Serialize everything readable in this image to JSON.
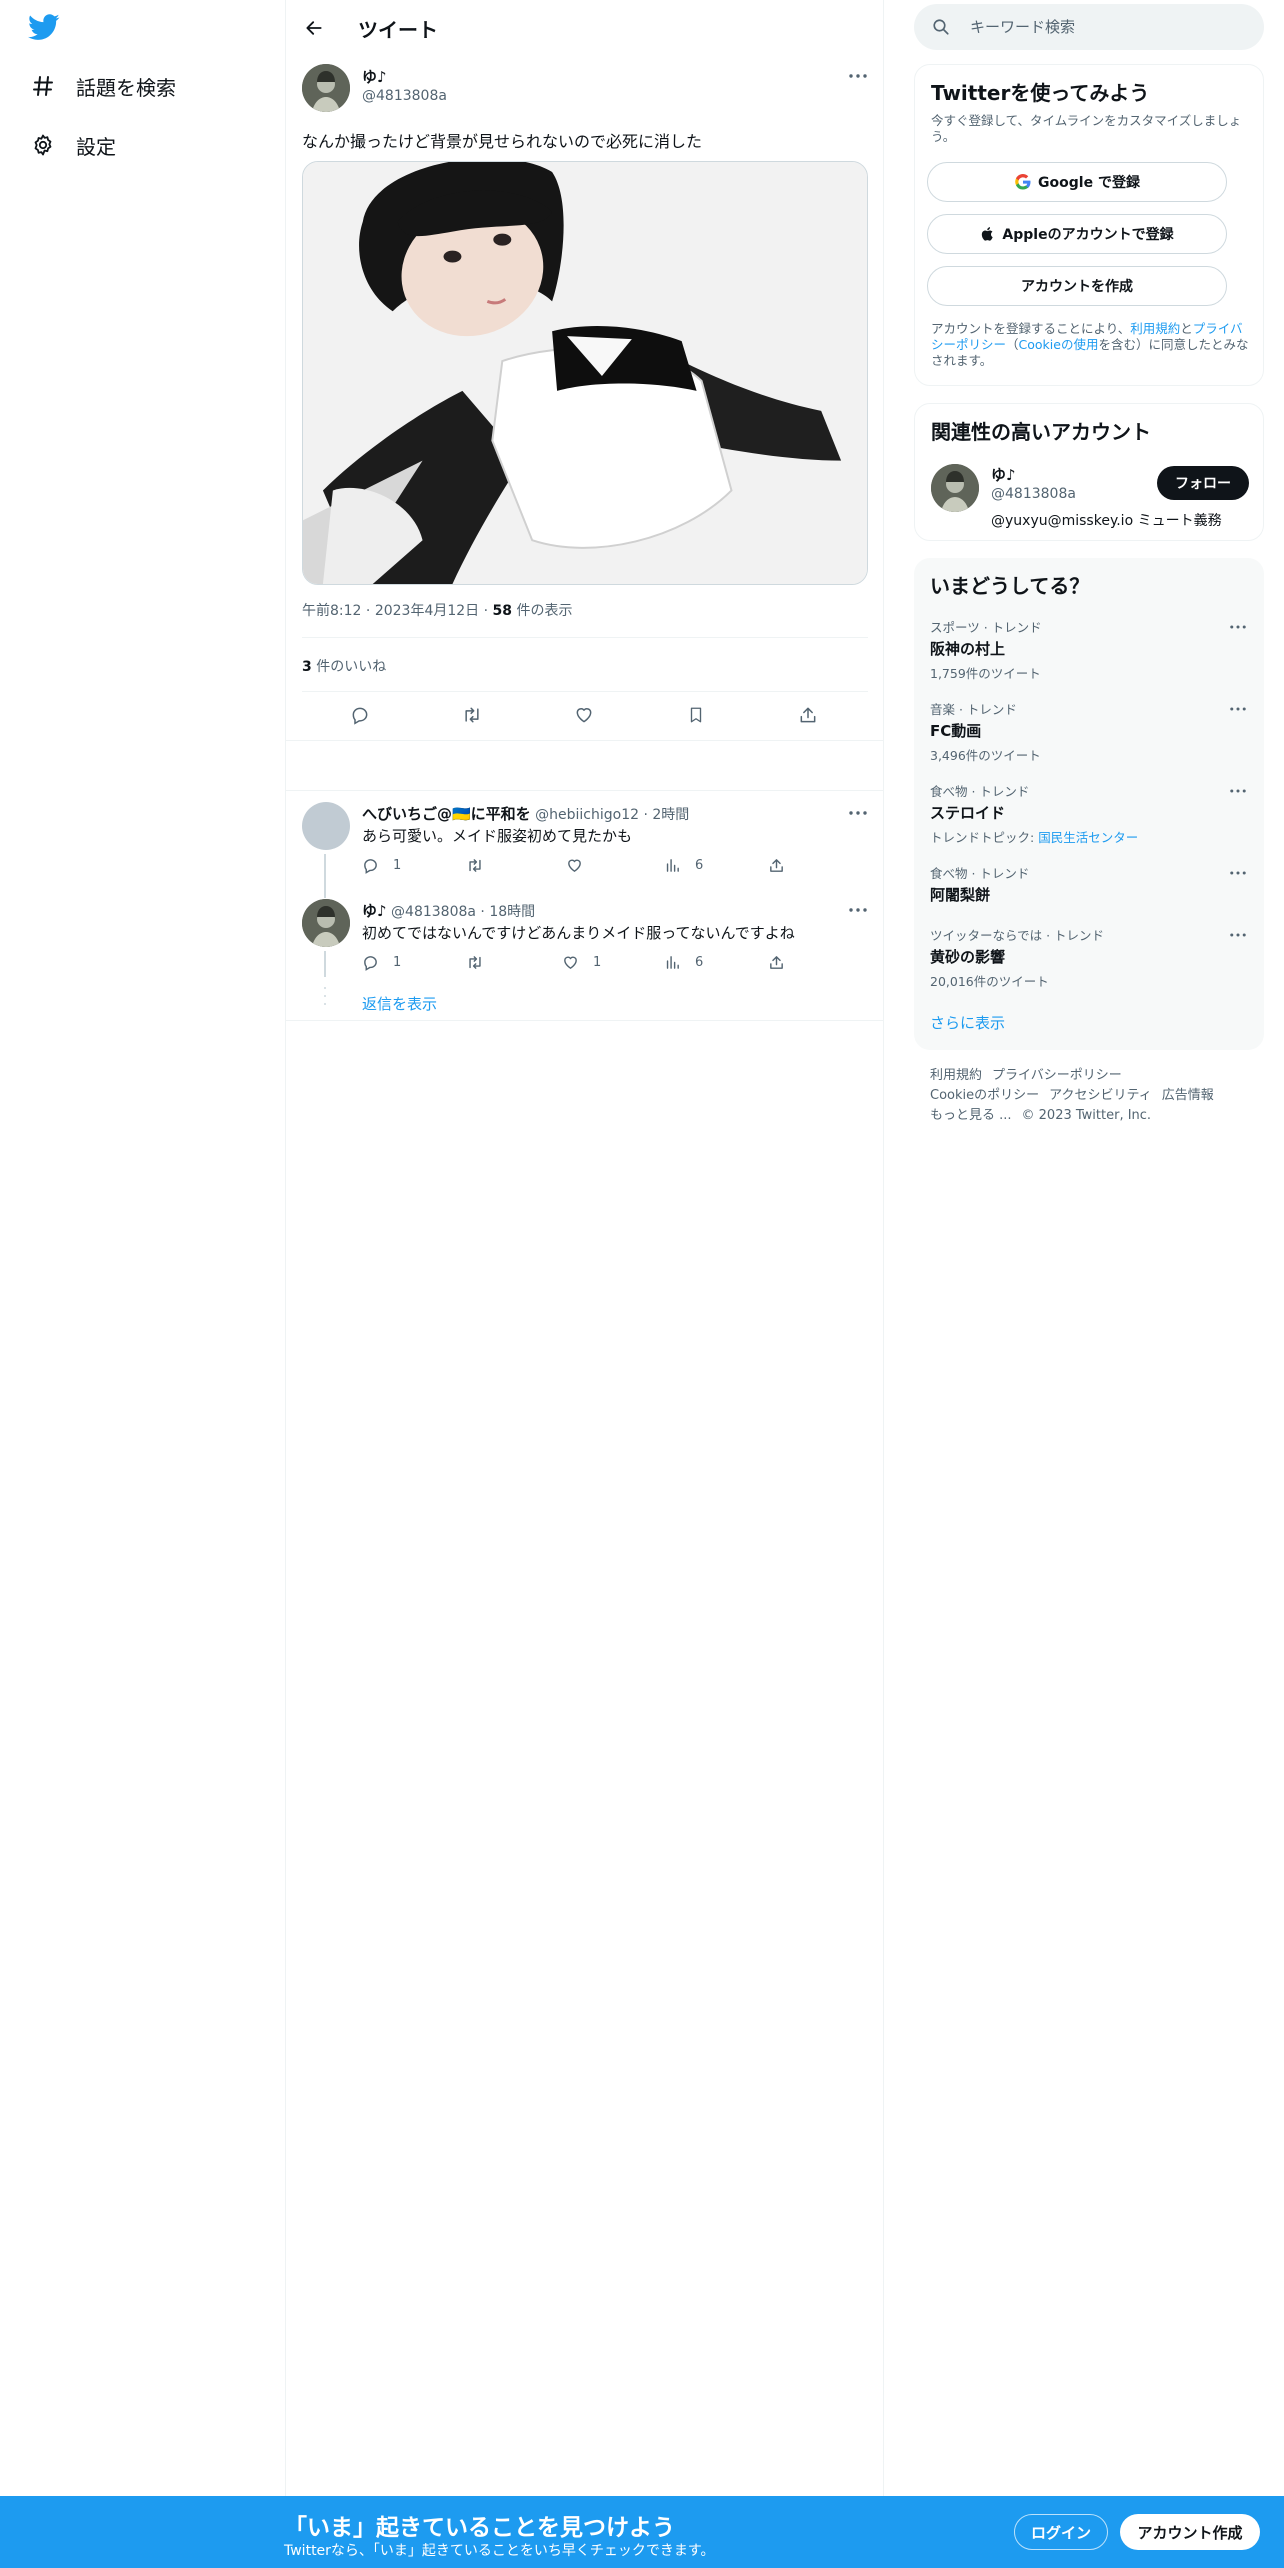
{
  "nav": {
    "logo_icon": "twitter-bird-icon",
    "items": [
      {
        "label": "話題を検索",
        "icon": "hashtag-icon"
      },
      {
        "label": "設定",
        "icon": "gear-icon"
      }
    ]
  },
  "header": {
    "title": "ツイート",
    "back_icon": "arrow-left-icon"
  },
  "tweet": {
    "author_name": "ゆ♪",
    "author_handle": "@4813808a",
    "text": "なんか撮ったけど背景が見せられないので必死に消した",
    "time": "午前8:12",
    "date": "2023年4月12日",
    "views_count": "58",
    "views_label": "件の表示",
    "likes_count": "3",
    "likes_label": "件のいいね"
  },
  "replies": [
    {
      "name": "へびいちご@🇺🇦に平和を",
      "handle": "@hebiichigo12",
      "time": "2時間",
      "text": "あら可愛い。メイド服姿初めて見たかも",
      "reply_count": "1",
      "retweet_count": "",
      "like_count": "",
      "view_count": "6"
    },
    {
      "name": "ゆ♪",
      "handle": "@4813808a",
      "time": "18時間",
      "text": "初めてではないんですけどあんまりメイド服ってないんですよね",
      "reply_count": "1",
      "retweet_count": "",
      "like_count": "1",
      "view_count": "6"
    }
  ],
  "show_replies": "返信を表示",
  "search": {
    "placeholder": "キーワード検索"
  },
  "signup_card": {
    "title": "Twitterを使ってみよう",
    "subtitle": "今すぐ登録して、タイムラインをカスタマイズしましょう。",
    "google_btn": "Google で登録",
    "apple_btn": "Appleのアカウントで登録",
    "create_btn": "アカウントを作成",
    "legal_prefix": "アカウントを登録することにより、",
    "legal_terms": "利用規約",
    "legal_and": "と",
    "legal_privacy": "プライバシーポリシー",
    "legal_paren_open": "（",
    "legal_cookie": "Cookieの使用",
    "legal_suffix": "を含む）に同意したとみなされます。"
  },
  "related": {
    "title": "関連性の高いアカウント",
    "name": "ゆ♪",
    "handle": "@4813808a",
    "bio": "@yuxyu@misskey.io ミュート義務",
    "follow_btn": "フォロー"
  },
  "trends": {
    "title": "いまどうしてる？",
    "items": [
      {
        "context": "スポーツ · トレンド",
        "name": "阪神の村上",
        "count": "1,759件のツイート",
        "topic_label": "",
        "topic_link": ""
      },
      {
        "context": "音楽 · トレンド",
        "name": "FC動画",
        "count": "3,496件のツイート",
        "topic_label": "",
        "topic_link": ""
      },
      {
        "context": "食べ物 · トレンド",
        "name": "ステロイド",
        "count": "",
        "topic_label": "トレンドトピック: ",
        "topic_link": "国民生活センター"
      },
      {
        "context": "食べ物 · トレンド",
        "name": "阿闍梨餅",
        "count": "",
        "topic_label": "",
        "topic_link": ""
      },
      {
        "context": "ツイッターならでは · トレンド",
        "name": "黄砂の影響",
        "count": "20,016件のツイート",
        "topic_label": "",
        "topic_link": ""
      }
    ],
    "show_more": "さらに表示"
  },
  "footer": {
    "links": [
      "利用規約",
      "プライバシーポリシー",
      "Cookieのポリシー",
      "アクセシビリティ",
      "広告情報",
      "もっと見る ..."
    ],
    "copyright": "© 2023 Twitter, Inc."
  },
  "bottom_bar": {
    "title": "「いま」起きていることを見つけよう",
    "subtitle": "Twitterなら、「いま」起きていることをいち早くチェックできます。",
    "login": "ログイン",
    "signup": "アカウント作成"
  },
  "colors": {
    "accent": "#1d9bf0",
    "text": "#0f1419",
    "secondary": "#536471",
    "border": "#eff3f4"
  }
}
